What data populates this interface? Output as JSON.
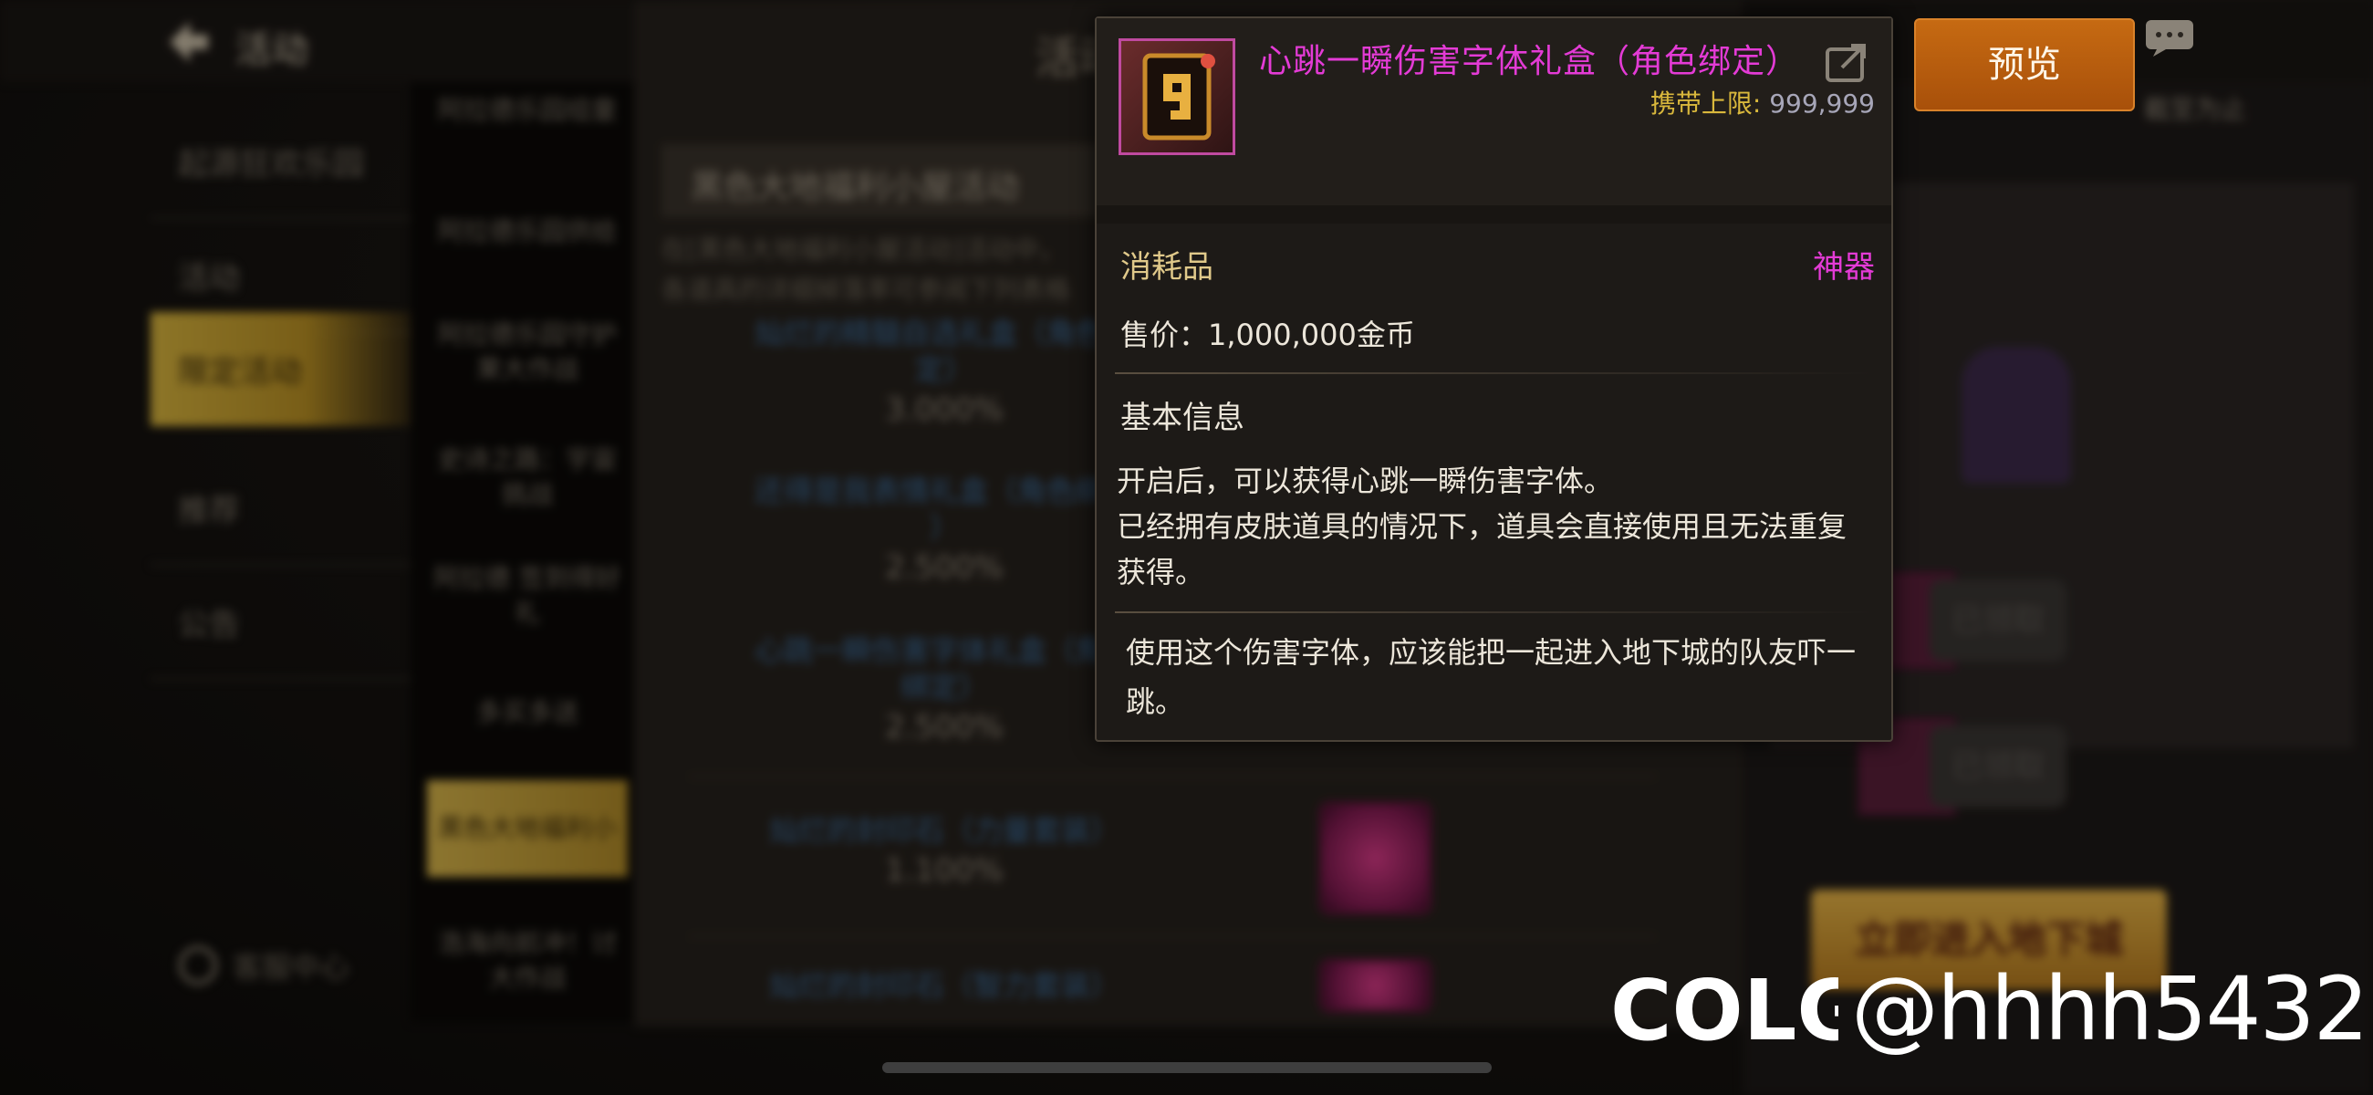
{
  "background": {
    "top_title": "活动",
    "nav_items": [
      "起源狂欢乐园",
      "活动",
      "限定活动",
      "推荐",
      "公告"
    ],
    "active_nav": "限定活动",
    "support_label": "客服中心",
    "sub_items": [
      "阿拉德乐园组童",
      "阿拉德乐园供给",
      "阿拉德乐园守护\n果大作战",
      "史诗之路：宇宙\n挑战",
      "阿拉德\n签到得好礼",
      "多买多送",
      "黑色大地福利小",
      "浩海向前冲！讨\n大作战"
    ],
    "panel_title": "活动",
    "panel_header": "黑色大地福利小屋活动",
    "panel_desc_1": "在[黑色大地福利小屋活动]活动中，",
    "panel_desc_2": "各道具的详细掉落率可参阅下列表格",
    "prob_items": [
      {
        "name": "灿烂的精髓自选礼盒（角色绑\n定）",
        "rate": "3.000%"
      },
      {
        "name": "还得是我表情礼盒（角色绑定\n）",
        "rate": "2.500%"
      },
      {
        "name": "心跳一瞬伤害字体礼盒（角色\n绑定）",
        "rate": "2.500%"
      },
      {
        "name": "灿烂的封印石（力量套装）",
        "rate": "1.100%"
      },
      {
        "name": "灿烂的封印石（智力套装）",
        "rate": ""
      }
    ],
    "claimed_label": "已领取",
    "enter_dungeon": "立即进入地下城",
    "deadline_text": "截至为止"
  },
  "tooltip": {
    "item_name": "心跳一瞬伤害字体礼盒（角色绑定）",
    "carry_limit_label": "携带上限:",
    "carry_limit_value": "999,999",
    "item_type": "消耗品",
    "rarity": "神器",
    "price": "售价：1,000,000金币",
    "section_title": "基本信息",
    "description_1": "开启后，可以获得心跳一瞬伤害字体。",
    "description_2": "已经拥有皮肤道具的情况下，道具会直接使用且无法重复获得。",
    "flavor_text": "使用这个伤害字体，应该能把一起进入地下城的队友吓一跳。",
    "icon": "damage-font-9-icon"
  },
  "preview_button": "预览",
  "watermark": {
    "logo_text": "COLG",
    "handle": "@hhhh5432"
  },
  "colors": {
    "rarity_magenta": "#e43bd6",
    "gold_label": "#d9b83c",
    "preview_orange": "#c66a12"
  }
}
